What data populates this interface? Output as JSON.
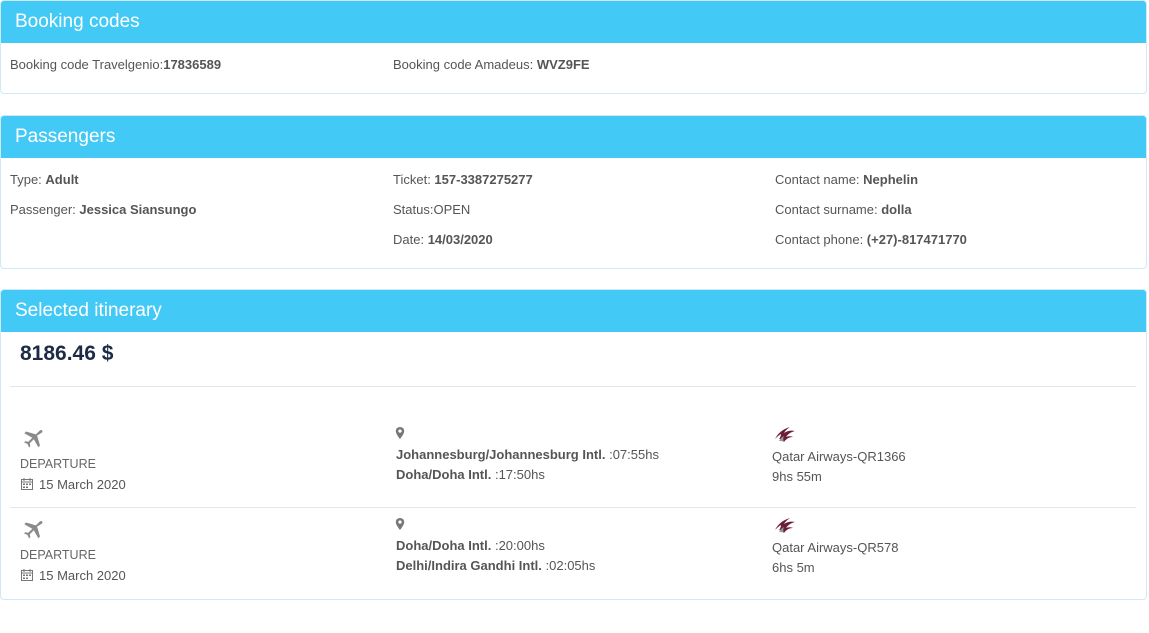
{
  "booking": {
    "title": "Booking codes",
    "travelgenio_label": "Booking code Travelgenio:",
    "travelgenio_value": "17836589",
    "amadeus_label": "Booking code Amadeus: ",
    "amadeus_value": "WVZ9FE"
  },
  "passengers": {
    "title": "Passengers",
    "type_label": "Type: ",
    "type_value": "Adult",
    "passenger_label": "Passenger: ",
    "passenger_value": "Jessica Siansungo",
    "ticket_label": "Ticket: ",
    "ticket_value": "157-3387275277",
    "status_label": "Status:",
    "status_value": "OPEN",
    "date_label": "Date: ",
    "date_value": "14/03/2020",
    "contact_name_label": "Contact name: ",
    "contact_name_value": "Nephelin",
    "contact_surname_label": "Contact surname: ",
    "contact_surname_value": "dolla",
    "contact_phone_label": "Contact phone: ",
    "contact_phone_value": "(+27)-817471770"
  },
  "itinerary": {
    "title": "Selected itinerary",
    "price": "8186.46 $",
    "segments": [
      {
        "direction": "DEPARTURE",
        "date": "15 March 2020",
        "from_place": "Johannesburg/Johannesburg Intl.",
        "from_time": " :07:55hs",
        "to_place": "Doha/Doha Intl.",
        "to_time": " :17:50hs",
        "airline": "Qatar Airways-QR1366",
        "duration": "9hs 55m"
      },
      {
        "direction": "DEPARTURE",
        "date": "15 March 2020",
        "from_place": "Doha/Doha Intl.",
        "from_time": " :20:00hs",
        "to_place": "Delhi/Indira Gandhi Intl.",
        "to_time": " :02:05hs",
        "airline": "Qatar Airways-QR578",
        "duration": "6hs 5m"
      }
    ]
  },
  "colors": {
    "header": "#43c9f5",
    "price": "#1d2b45",
    "airline_logo": "#6b1d3c"
  },
  "icons": [
    "plane-icon",
    "calendar-icon",
    "map-pin-icon",
    "qatar-airways-logo"
  ]
}
